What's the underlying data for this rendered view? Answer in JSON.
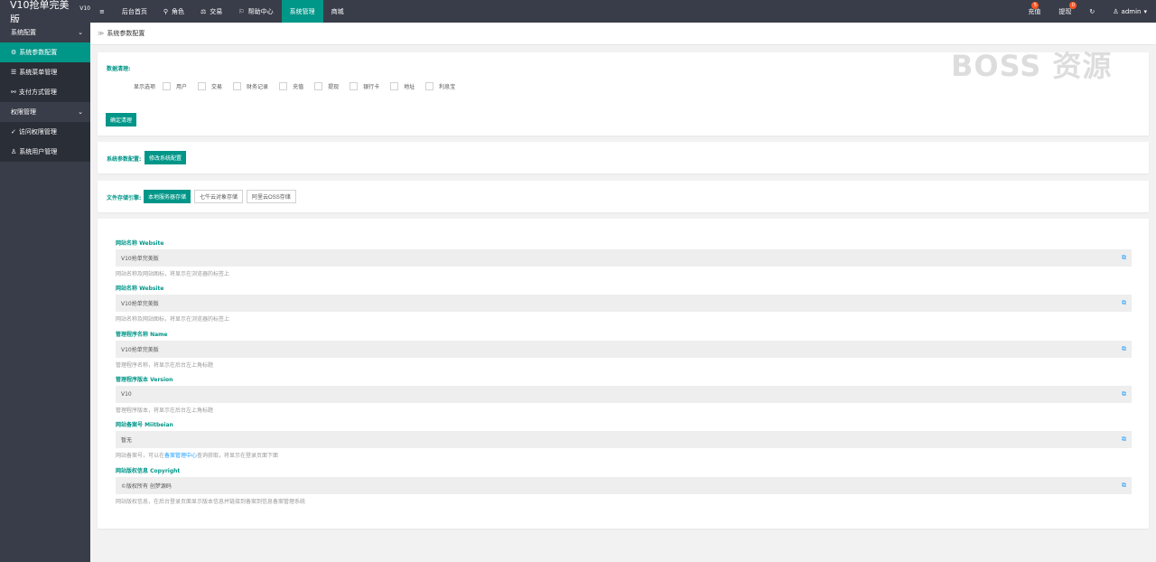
{
  "app": {
    "logo": "V10抢单完美版",
    "logo_sup": "V10"
  },
  "topnav": [
    {
      "icon": "≡",
      "label": ""
    },
    {
      "icon": "",
      "label": "后台首页"
    },
    {
      "icon": "⚲",
      "label": "角色"
    },
    {
      "icon": "⚖",
      "label": "交易"
    },
    {
      "icon": "⚐",
      "label": "帮助中心"
    },
    {
      "icon": "",
      "label": "系统管理",
      "active": true
    },
    {
      "icon": "",
      "label": "商城"
    }
  ],
  "topright": {
    "recharge": "充值",
    "recharge_badge": "5",
    "withdraw": "提现",
    "withdraw_badge": "0",
    "refresh_icon": "↻",
    "user": "admin"
  },
  "sidebar": {
    "group1": "系统配置",
    "items1": [
      {
        "icon": "⚙",
        "label": "系统参数配置",
        "active": true
      },
      {
        "icon": "☰",
        "label": "系统菜单管理"
      },
      {
        "icon": "⚯",
        "label": "支付方式管理"
      }
    ],
    "group2": "权限管理",
    "items2": [
      {
        "icon": "✓",
        "label": "访问权限管理"
      },
      {
        "icon": "♙",
        "label": "系统用户管理"
      }
    ]
  },
  "breadcrumb": {
    "sep": "≫",
    "label": "系统参数配置"
  },
  "data_clean": {
    "title": "数据清理:",
    "display_label": "显示选项",
    "options": [
      "用户",
      "交易",
      "财务记录",
      "充值",
      "提现",
      "银行卡",
      "地址",
      "利息宝"
    ],
    "confirm_button": "确定清理"
  },
  "sys_params": {
    "title": "系统参数配置:",
    "button": "修改系统配置"
  },
  "storage": {
    "title": "文件存储引擎:",
    "options": [
      "本地服务器存储",
      "七牛云对象存储",
      "阿里云OSS存储"
    ]
  },
  "watermark": "BOSS 资源",
  "fields": [
    {
      "title": "网站名称 Website",
      "value": "V10抢单完美版",
      "hint": "网站名称及网站图标，将显示在浏览器的标签上"
    },
    {
      "title": "网站名称 Website",
      "value": "V10抢单完美版",
      "hint": "网站名称及网站图标，将显示在浏览器的标签上"
    },
    {
      "title": "管理程序名称 Name",
      "value": "V10抢单完美版",
      "hint": "管理程序名称，将显示在后台左上角标题"
    },
    {
      "title": "管理程序版本 Version",
      "value": "V10",
      "hint": "管理程序版本，将显示在后台左上角标题"
    },
    {
      "title": "网站备案号 Miitbeian",
      "value": "暂无",
      "hint_pre": "网站备案号，可以在",
      "hint_link": "备案管理中心",
      "hint_post": "查询获取，将显示在登录页面下面"
    },
    {
      "title": "网站版权信息 Copyright",
      "value": "©版权所有 创梦源码",
      "hint": "网站版权信息，在后台登录页面显示版本信息并链接到备案到信息备案管理系统"
    }
  ]
}
